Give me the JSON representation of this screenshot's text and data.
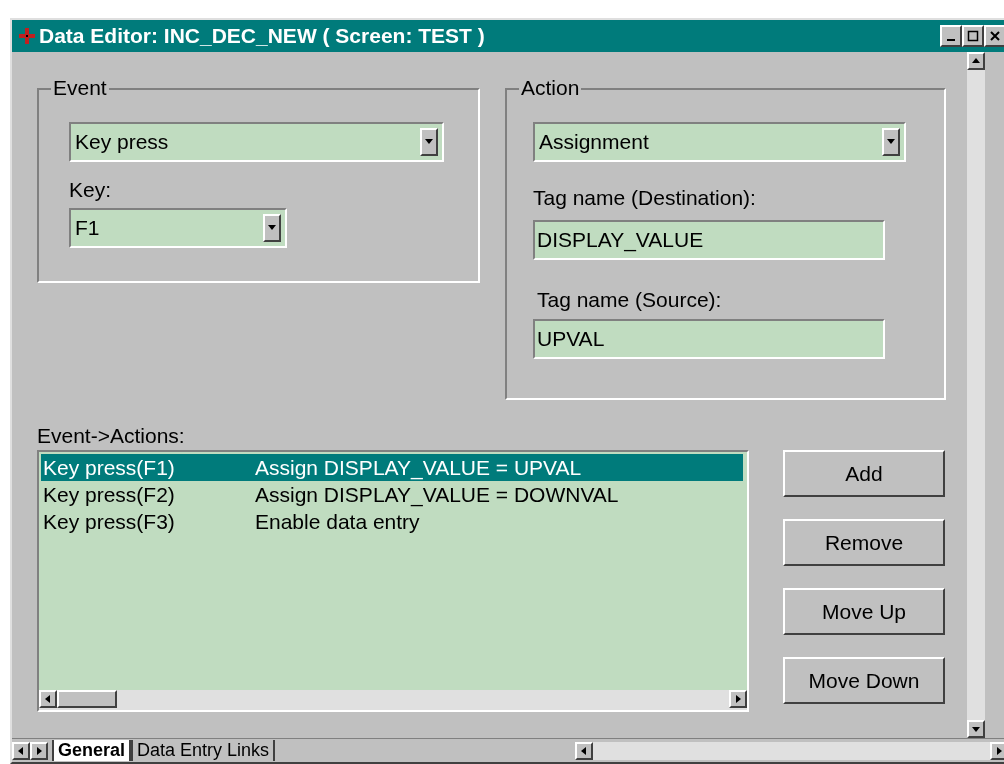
{
  "window": {
    "title": "Data Editor: INC_DEC_NEW ( Screen: TEST )"
  },
  "event": {
    "label": "Event",
    "type": "Key press",
    "key_label": "Key:",
    "key": "F1"
  },
  "action": {
    "label": "Action",
    "type": "Assignment",
    "destination_label": "Tag name (Destination):",
    "destination": "DISPLAY_VALUE",
    "source_label": "Tag name (Source):",
    "source": "UPVAL"
  },
  "event_actions": {
    "label": "Event->Actions:",
    "rows": [
      {
        "event": "Key press(F1)",
        "action": "Assign DISPLAY_VALUE = UPVAL",
        "selected": true
      },
      {
        "event": "Key press(F2)",
        "action": "Assign DISPLAY_VALUE = DOWNVAL",
        "selected": false
      },
      {
        "event": "Key press(F3)",
        "action": "Enable data entry",
        "selected": false
      }
    ]
  },
  "buttons": [
    "Add",
    "Remove",
    "Move Up",
    "Move Down"
  ],
  "tabs": [
    {
      "label": "General",
      "selected": true
    },
    {
      "label": "Data Entry Links",
      "selected": false
    }
  ]
}
